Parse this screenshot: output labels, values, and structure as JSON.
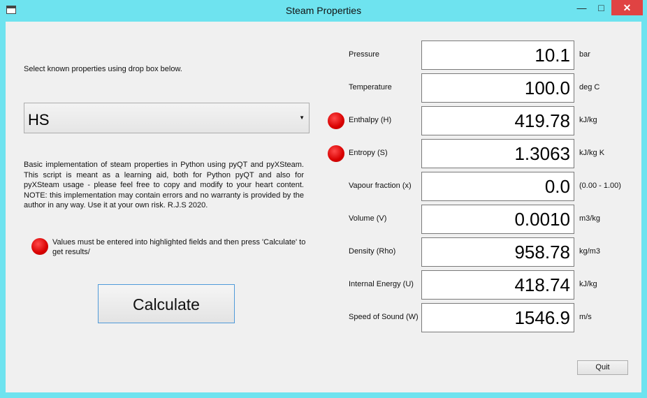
{
  "window": {
    "title": "Steam Properties",
    "minimize": "—",
    "maximize": "□",
    "close": "✕"
  },
  "select_label": "Select known properties using drop box below.",
  "combo": {
    "value": "HS",
    "arrow": "▼"
  },
  "description": "Basic implementation of steam properties in Python using pyQT and pyXSteam. This script is meant as a learning aid, both for Python pyQT and also for pyXSteam usage - please feel free to copy and modify to your heart content. NOTE: this implementation may contain errors and no warranty is provided by the author in any way. Use it at your own risk. R.J.S 2020.",
  "note": "Values must be entered into highlighted fields and then press 'Calculate' to get results/",
  "calculate_label": "Calculate",
  "quit_label": "Quit",
  "indicator_color": "#e00000",
  "rows": [
    {
      "label": "Pressure",
      "value": "10.1",
      "unit": "bar",
      "highlighted": false
    },
    {
      "label": "Temperature",
      "value": "100.0",
      "unit": "deg C",
      "highlighted": false
    },
    {
      "label": "Enthalpy (H)",
      "value": "419.78",
      "unit": "kJ/kg",
      "highlighted": true
    },
    {
      "label": "Entropy (S)",
      "value": "1.3063",
      "unit": "kJ/kg K",
      "highlighted": true
    },
    {
      "label": "Vapour fraction (x)",
      "value": "0.0",
      "unit": "(0.00 - 1.00)",
      "highlighted": false
    },
    {
      "label": "Volume (V)",
      "value": "0.0010",
      "unit": "m3/kg",
      "highlighted": false
    },
    {
      "label": "Density (Rho)",
      "value": "958.78",
      "unit": "kg/m3",
      "highlighted": false
    },
    {
      "label": "Internal Energy (U)",
      "value": "418.74",
      "unit": "kJ/kg",
      "highlighted": false
    },
    {
      "label": "Speed of Sound (W)",
      "value": "1546.9",
      "unit": "m/s",
      "highlighted": false
    }
  ]
}
